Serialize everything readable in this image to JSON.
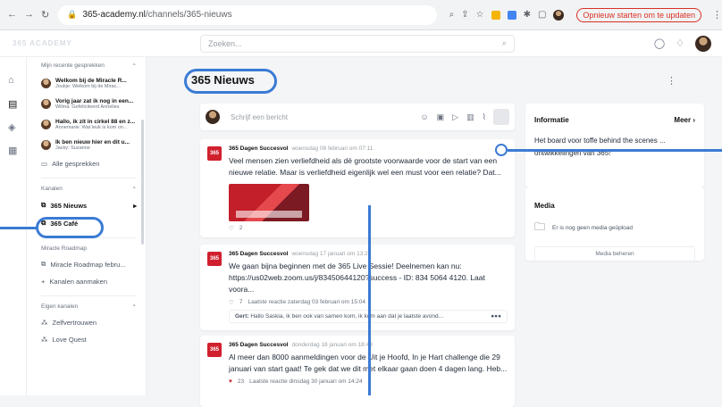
{
  "browser": {
    "url_host": "365-academy.nl",
    "url_path": "/channels/365-nieuws",
    "update_button": "Opnieuw starten om te updaten"
  },
  "app": {
    "brand": "365 ACADEMY",
    "search_placeholder": "Zoeken..."
  },
  "sidebar": {
    "recent_header": "Mijn recente gesprekken",
    "conversations": [
      {
        "title": "Welkom bij de Miracle R...",
        "snippet": "Joukje: Welkom bij de Mirac..."
      },
      {
        "title": "Vorig jaar zat ik nog in een...",
        "snippet": "Wilma: Gefeliciteerd Annelies"
      },
      {
        "title": "Hallo, ik zit in cirkel 88 en z...",
        "snippet": "Annemarie: Wat leuk is kom on..."
      },
      {
        "title": "Ik ben nieuw hier en dit u...",
        "snippet": "Jacky: Suzanne"
      }
    ],
    "all_conversations": "Alle gesprekken",
    "channels_header": "Kanalen",
    "channels": [
      "365 Nieuws",
      "365 Café"
    ],
    "roadmap_header": "Miracle Roadmap",
    "roadmap_items": [
      "Miracle Roadmap febru...",
      "Kanalen aanmaken"
    ],
    "own_header": "Eigen kanalen",
    "own_items": [
      "Zelfvertrouwen",
      "Love Quest"
    ]
  },
  "main": {
    "channel_title": "365 Nieuws",
    "composer_placeholder": "Schrijf een bericht",
    "posts": [
      {
        "author": "365 Dagen Succesvol",
        "date": "woensdag 08 februari om 07:11",
        "body": "Veel mensen zien verliefdheid als dé grootste voorwaarde voor de start van een nieuwe relatie. Maar is verliefdheid eigenlijk wel een must voor een relatie? Dat...",
        "likes": "2"
      },
      {
        "author": "365 Dagen Succesvol",
        "date": "woensdag 17 januari om 13:22",
        "body": "We gaan bijna beginnen met de 365 Live Sessie! Deelnemen kan nu: https://us02web.zoom.us/j/83450644120?success - ID: 834 5064 4120. Laat voora...",
        "likes": "7",
        "last_reply": "Laatste reactie  zaterdag 03 februari om 15:04",
        "reply_author": "Gert:",
        "reply_text": "Hallo Saskia, ik ben ook van samen kom, ik kom aan dat je laatste avond..."
      },
      {
        "author": "365 Dagen Succesvol",
        "date": "donderdag 18 januari om 18:48",
        "body": "Al meer dan 8000 aanmeldingen voor de Uit je Hoofd, In je Hart challenge die 29 januari van start gaat! Te gek dat we dit met elkaar gaan doen 4 dagen lang. Heb...",
        "likes": "23",
        "last_reply": "Laatste reactie  dinsdag 30 januari om 14:24"
      }
    ]
  },
  "info": {
    "title": "Informatie",
    "more": "Meer",
    "text": "Het board voor toffe behind the scenes ... ontwikkelingen van 365!"
  },
  "media": {
    "title": "Media",
    "empty": "Er is nog geen media geüpload",
    "manage": "Media beheren"
  }
}
